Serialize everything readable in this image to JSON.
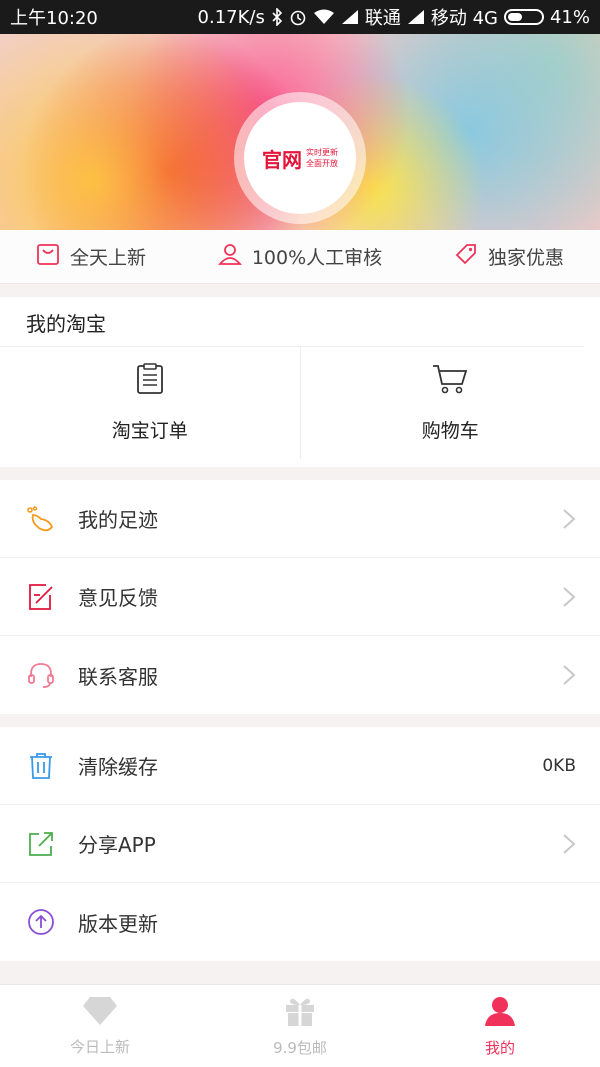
{
  "status_bar": {
    "time": "上午10:20",
    "speed": "0.17K/s",
    "carrier1": "联通",
    "carrier2": "移动 4G",
    "battery": "41%"
  },
  "header": {
    "logo_main": "官网",
    "logo_sub_1": "实时更新",
    "logo_sub_2": "全面开放"
  },
  "features": [
    {
      "label": "全天上新",
      "icon": "bag-icon"
    },
    {
      "label": "100%人工审核",
      "icon": "person-icon"
    },
    {
      "label": "独家优惠",
      "icon": "tag-icon"
    }
  ],
  "my_taobao": {
    "title": "我的淘宝",
    "items": [
      {
        "label": "淘宝订单",
        "icon": "order-list-icon"
      },
      {
        "label": "购物车",
        "icon": "cart-icon"
      }
    ]
  },
  "menu1": [
    {
      "label": "我的足迹",
      "icon": "footprint-icon"
    },
    {
      "label": "意见反馈",
      "icon": "feedback-icon"
    },
    {
      "label": "联系客服",
      "icon": "headset-icon"
    }
  ],
  "menu2": [
    {
      "label": "清除缓存",
      "icon": "trash-icon",
      "value": "0KB"
    },
    {
      "label": "分享APP",
      "icon": "share-icon"
    },
    {
      "label": "版本更新",
      "icon": "update-icon"
    }
  ],
  "tabbar": [
    {
      "label": "今日上新",
      "icon": "diamond-icon"
    },
    {
      "label": "9.9包邮",
      "icon": "gift-icon"
    },
    {
      "label": "我的",
      "icon": "user-icon",
      "active": true
    }
  ],
  "colors": {
    "accent": "#f0325a",
    "brand_red": "#e2163a"
  }
}
